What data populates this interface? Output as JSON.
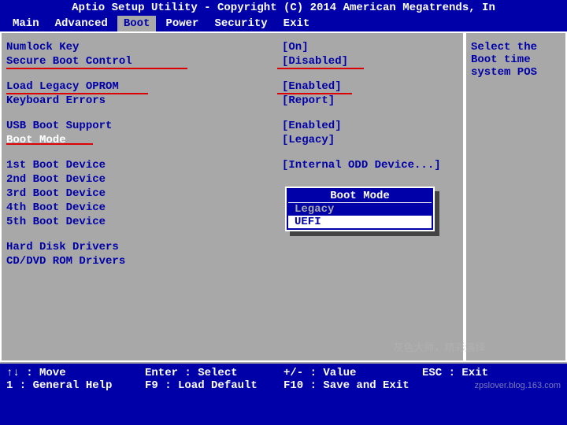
{
  "title": "Aptio Setup Utility - Copyright (C) 2014 American Megatrends, In",
  "menu": {
    "items": [
      "Main",
      "Advanced",
      "Boot",
      "Power",
      "Security",
      "Exit"
    ],
    "active_index": 2
  },
  "settings": [
    {
      "label": "Numlock Key",
      "value": "[On]"
    },
    {
      "label": "Secure Boot Control",
      "value": "[Disabled]"
    },
    {
      "label": "",
      "value": ""
    },
    {
      "label": "Load Legacy OPROM",
      "value": "[Enabled]"
    },
    {
      "label": "Keyboard Errors",
      "value": "[Report]"
    },
    {
      "label": "",
      "value": ""
    },
    {
      "label": "USB Boot Support",
      "value": "[Enabled]"
    },
    {
      "label": "Boot Mode",
      "value": "[Legacy]",
      "selected": true
    },
    {
      "label": "",
      "value": ""
    },
    {
      "label": "1st Boot Device",
      "value": "[Internal ODD Device...]"
    },
    {
      "label": "2nd Boot Device",
      "value": ""
    },
    {
      "label": "3rd Boot Device",
      "value": ""
    },
    {
      "label": "4th Boot Device",
      "value": ""
    },
    {
      "label": "5th Boot Device",
      "value": ""
    }
  ],
  "sections": [
    "Hard Disk Drivers",
    "CD/DVD ROM Drivers"
  ],
  "popup": {
    "title": "Boot Mode",
    "options": [
      "Legacy",
      "UEFI"
    ],
    "selected_index": 1
  },
  "help_text": "Select the Boot time system POS",
  "footer": {
    "row1": {
      "a": "↑↓ : Move",
      "b": "Enter : Select",
      "c": "+/- : Value",
      "d": "ESC : Exit"
    },
    "row2": {
      "a": "1 : General Help",
      "b": "F9 : Load Default",
      "c": "F10 : Save and Exit",
      "d": ""
    }
  },
  "watermark1": "灰色大师，精彩演绎.",
  "watermark2": "zpslover.blog.163.com"
}
